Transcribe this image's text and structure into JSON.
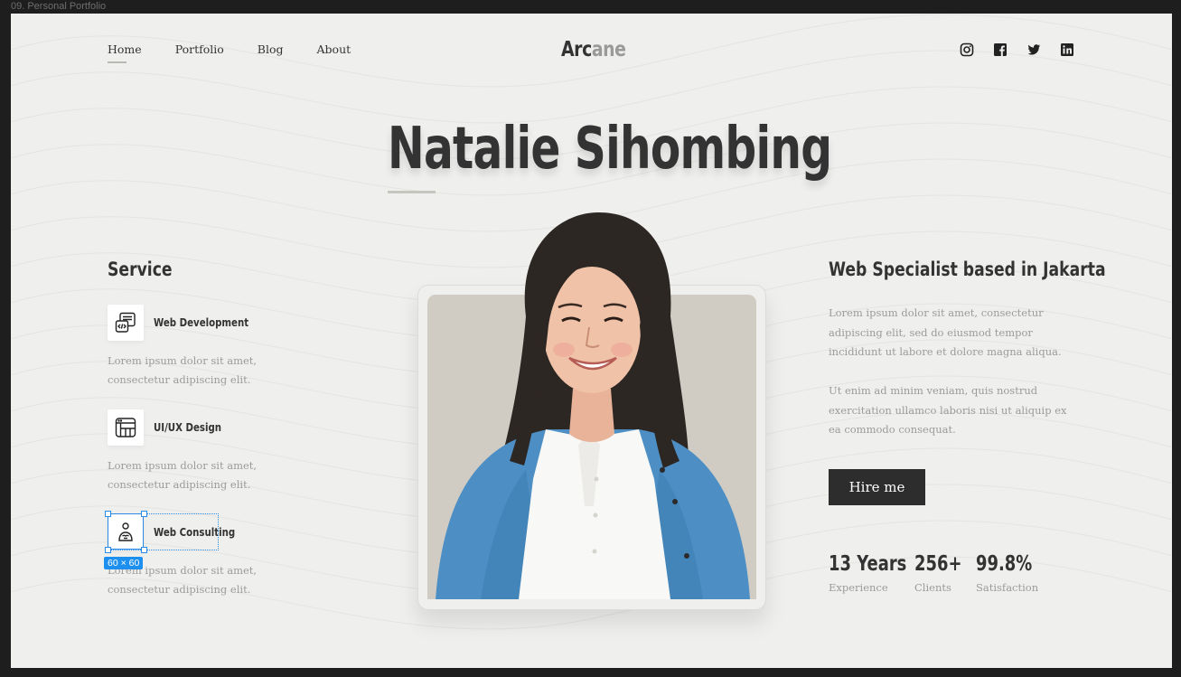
{
  "frame": {
    "label": "09. Personal Portfolio"
  },
  "nav": {
    "items": [
      {
        "label": "Home",
        "active": true
      },
      {
        "label": "Portfolio",
        "active": false
      },
      {
        "label": "Blog",
        "active": false
      },
      {
        "label": "About",
        "active": false
      }
    ]
  },
  "logo": {
    "dark": "Arc",
    "light": "ane"
  },
  "social": {
    "icons": [
      "instagram-icon",
      "facebook-icon",
      "twitter-icon",
      "linkedin-icon"
    ]
  },
  "hero": {
    "name": "Natalie Sihombing"
  },
  "services": {
    "title": "Service",
    "items": [
      {
        "name": "Web Development",
        "desc": "Lorem ipsum dolor sit amet, consectetur adipiscing elit.",
        "icon": "code-window-icon"
      },
      {
        "name": "UI/UX Design",
        "desc": "Lorem ipsum dolor sit amet, consectetur adipiscing elit.",
        "icon": "layout-icon"
      },
      {
        "name": "Web Consulting",
        "desc": "Lorem ipsum dolor sit amet, consectetur adipiscing elit.",
        "icon": "consultant-icon"
      }
    ]
  },
  "selection": {
    "size_label": "60 × 60"
  },
  "about": {
    "title": "Web Specialist based in Jakarta",
    "para1": "Lorem ipsum dolor sit amet, consectetur adipiscing elit, sed do eiusmod tempor incididunt ut labore et dolore magna aliqua.",
    "para2": "Ut enim ad minim veniam, quis nostrud exercitation ullamco laboris nisi ut aliquip ex ea commodo consequat.",
    "cta": "Hire me"
  },
  "stats": [
    {
      "value": "13 Years",
      "label": "Experience"
    },
    {
      "value": "256+",
      "label": "Clients"
    },
    {
      "value": "99.8%",
      "label": "Satisfaction"
    }
  ],
  "colors": {
    "accent_dark": "#2d2d2d",
    "muted_text": "#9b9b9b",
    "background": "#efefed",
    "selection": "#1d8fee"
  }
}
